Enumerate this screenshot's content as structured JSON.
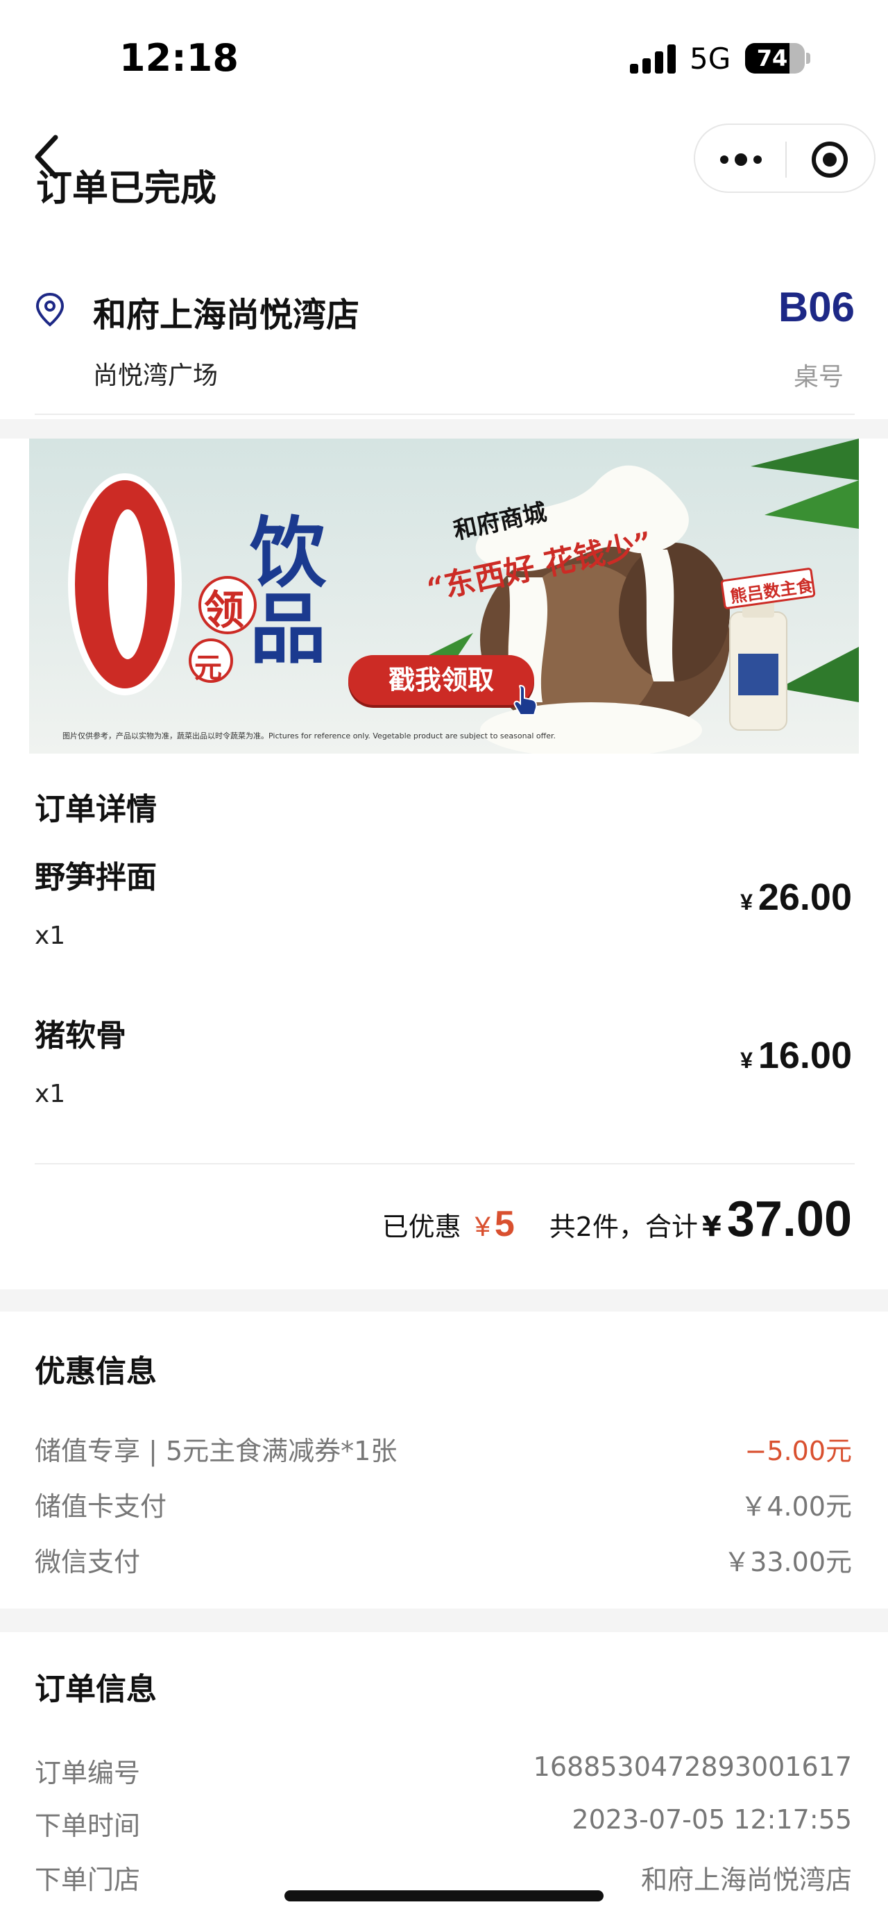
{
  "status_bar": {
    "time": "12:18",
    "network": "5G",
    "battery_percent": 74
  },
  "nav": {
    "partial_title": "订单已完成"
  },
  "store": {
    "name": "和府上海尚悦湾店",
    "sub": "尚悦湾广场",
    "table_no": "B06",
    "table_label": "桌号"
  },
  "banner": {
    "zero": "0",
    "ling": "领",
    "yuan": "元",
    "drink": "饮品",
    "brand": "和府商城",
    "slogan": "“东西好 花钱少”",
    "tag": "熊吕数主食",
    "button": "戳我领取",
    "fine_print": "图片仅供参考，产品以实物为准，蔬菜出品以时令蔬菜为准。Pictures for reference only. Vegetable product are subject to seasonal offer."
  },
  "order_detail": {
    "title": "订单详情",
    "currency": "¥",
    "items": [
      {
        "name": "野笋拌面",
        "qty": "x1",
        "price": "26.00"
      },
      {
        "name": "猪软骨",
        "qty": "x1",
        "price": "16.00"
      }
    ],
    "summary": {
      "discount_label": "已优惠",
      "discount_currency": "¥",
      "discount_value": "5",
      "count_label": "共2件，合计",
      "total_currency": "¥",
      "total": "37.00"
    }
  },
  "discount_info": {
    "title": "优惠信息",
    "rows": [
      {
        "label": "储值专享 | 5元主食满减券*1张",
        "value": "−5.00元"
      },
      {
        "label": "储值卡支付",
        "value": "￥4.00元"
      },
      {
        "label": "微信支付",
        "value": "￥33.00元"
      }
    ]
  },
  "order_info": {
    "title": "订单信息",
    "rows": [
      {
        "label": "订单编号",
        "value": "1688530472893001617"
      },
      {
        "label": "下单时间",
        "value": "2023-07-05 12:17:55"
      },
      {
        "label": "下单门店",
        "value": "和府上海尚悦湾店"
      }
    ]
  },
  "colors": {
    "accent_red": "#d9502f",
    "table_blue": "#1d2886",
    "banner_red": "#cc2b25"
  }
}
